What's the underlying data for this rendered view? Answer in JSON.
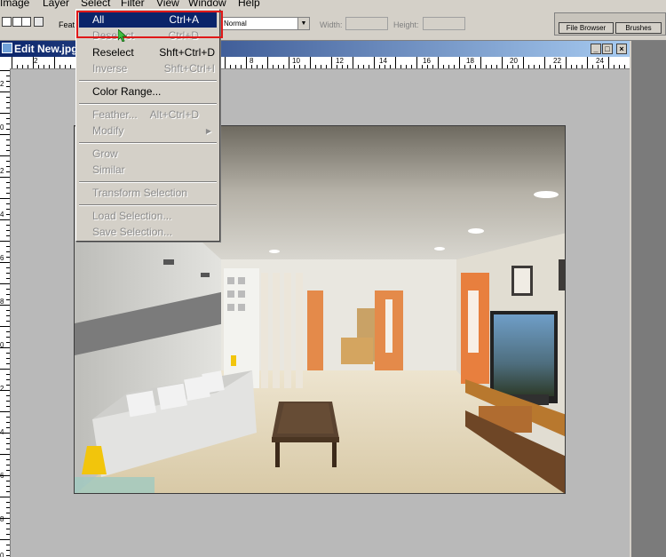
{
  "menubar": {
    "items": [
      "Image",
      "Layer",
      "Select",
      "Filter",
      "View",
      "Window",
      "Help"
    ]
  },
  "options_bar": {
    "feather_label": "Feat",
    "mode_value": "Normal",
    "width_label": "Width:",
    "height_label": "Height:"
  },
  "palette_well": {
    "tabs": [
      "File Browser",
      "Brushes"
    ]
  },
  "document": {
    "title": "Edit New.jpg",
    "ruler_top_labels": [
      "2",
      "8",
      "10",
      "12",
      "14",
      "16",
      "18",
      "20",
      "22",
      "24"
    ],
    "ruler_left_labels": [
      "2",
      "0",
      "2",
      "4",
      "6",
      "8",
      "0",
      "2",
      "4",
      "6",
      "8",
      "0"
    ]
  },
  "select_menu": {
    "items": [
      {
        "label": "All",
        "shortcut": "Ctrl+A",
        "enabled": true,
        "highlighted": true
      },
      {
        "label": "Deselect",
        "shortcut": "Ctrl+D",
        "enabled": false
      },
      {
        "label": "Reselect",
        "shortcut": "Shft+Ctrl+D",
        "enabled": true
      },
      {
        "label": "Inverse",
        "shortcut": "Shft+Ctrl+I",
        "enabled": false
      },
      {
        "label": "Color Range...",
        "shortcut": "",
        "enabled": true
      },
      {
        "label": "Feather...",
        "shortcut": "Alt+Ctrl+D",
        "enabled": false
      },
      {
        "label": "Modify",
        "shortcut": "",
        "enabled": false,
        "submenu": true
      },
      {
        "label": "Grow",
        "shortcut": "",
        "enabled": false
      },
      {
        "label": "Similar",
        "shortcut": "",
        "enabled": false
      },
      {
        "label": "Transform Selection",
        "shortcut": "",
        "enabled": false
      },
      {
        "label": "Load Selection...",
        "shortcut": "",
        "enabled": false
      },
      {
        "label": "Save Selection...",
        "shortcut": "",
        "enabled": false
      }
    ]
  },
  "colors": {
    "highlight": "#0a246a",
    "annotation": "#e01818",
    "menu_bg": "#d4d0c8"
  }
}
